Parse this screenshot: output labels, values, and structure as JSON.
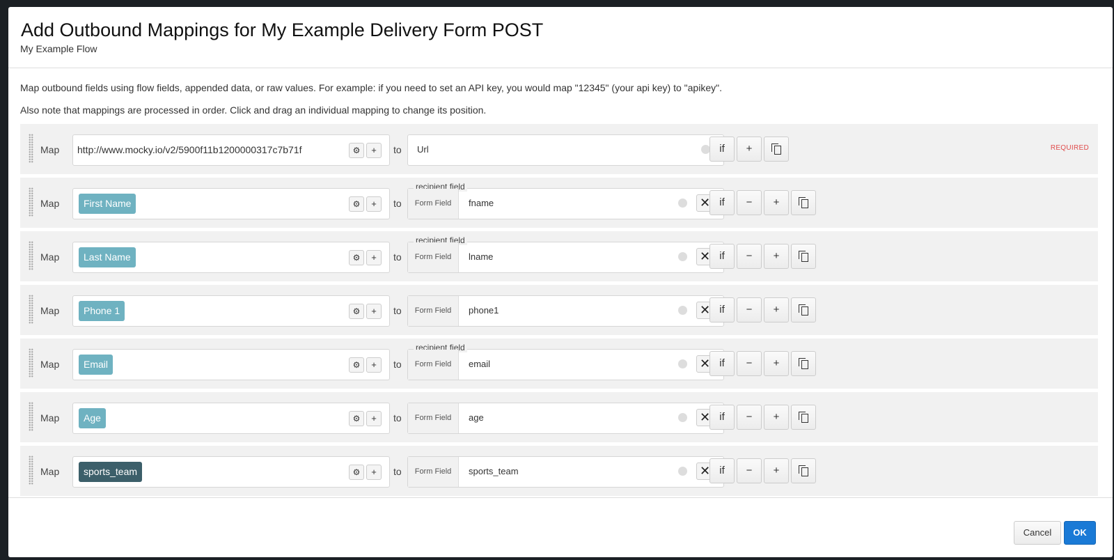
{
  "dialog": {
    "title": "Add Outbound Mappings for My Example Delivery Form POST",
    "subtitle": "My Example Flow",
    "intro_1": "Map outbound fields using flow fields, appended data, or raw values. For example: if you need to set an API key, you would map \"12345\" (your api key) to \"apikey\".",
    "intro_2": "Also note that mappings are processed in order. Click and drag an individual mapping to change its position."
  },
  "labels": {
    "map": "Map",
    "to": "to",
    "if": "if",
    "plus": "+",
    "minus": "−",
    "remove": "✕",
    "gear": "⚙",
    "form_field": "Form Field",
    "recipient_field": "recipient field",
    "required": "REQUIRED"
  },
  "mappings": [
    {
      "source": "http://www.mocky.io/v2/5900f11b1200000317c7b71f",
      "source_kind": "raw",
      "target": "Url",
      "target_kind": "plain",
      "legend": false,
      "required": true
    },
    {
      "source": "First Name",
      "source_kind": "flow-field",
      "target": "fname",
      "target_kind": "form-field",
      "legend": true
    },
    {
      "source": "Last Name",
      "source_kind": "flow-field",
      "target": "lname",
      "target_kind": "form-field",
      "legend": true
    },
    {
      "source": "Phone 1",
      "source_kind": "flow-field",
      "target": "phone1",
      "target_kind": "form-field",
      "legend": false
    },
    {
      "source": "Email",
      "source_kind": "flow-field",
      "target": "email",
      "target_kind": "form-field",
      "legend": true
    },
    {
      "source": "Age",
      "source_kind": "flow-field",
      "target": "age",
      "target_kind": "form-field",
      "legend": false
    },
    {
      "source": "sports_team",
      "source_kind": "appended-field",
      "target": "sports_team",
      "target_kind": "form-field",
      "legend": false
    }
  ],
  "footer": {
    "cancel_label": "Cancel",
    "ok_label": "OK"
  },
  "colors": {
    "flow_chip": "#6fb2c1",
    "appended_chip": "#3c5f6a",
    "primary": "#1a7ad6",
    "required": "#e04b4b"
  }
}
